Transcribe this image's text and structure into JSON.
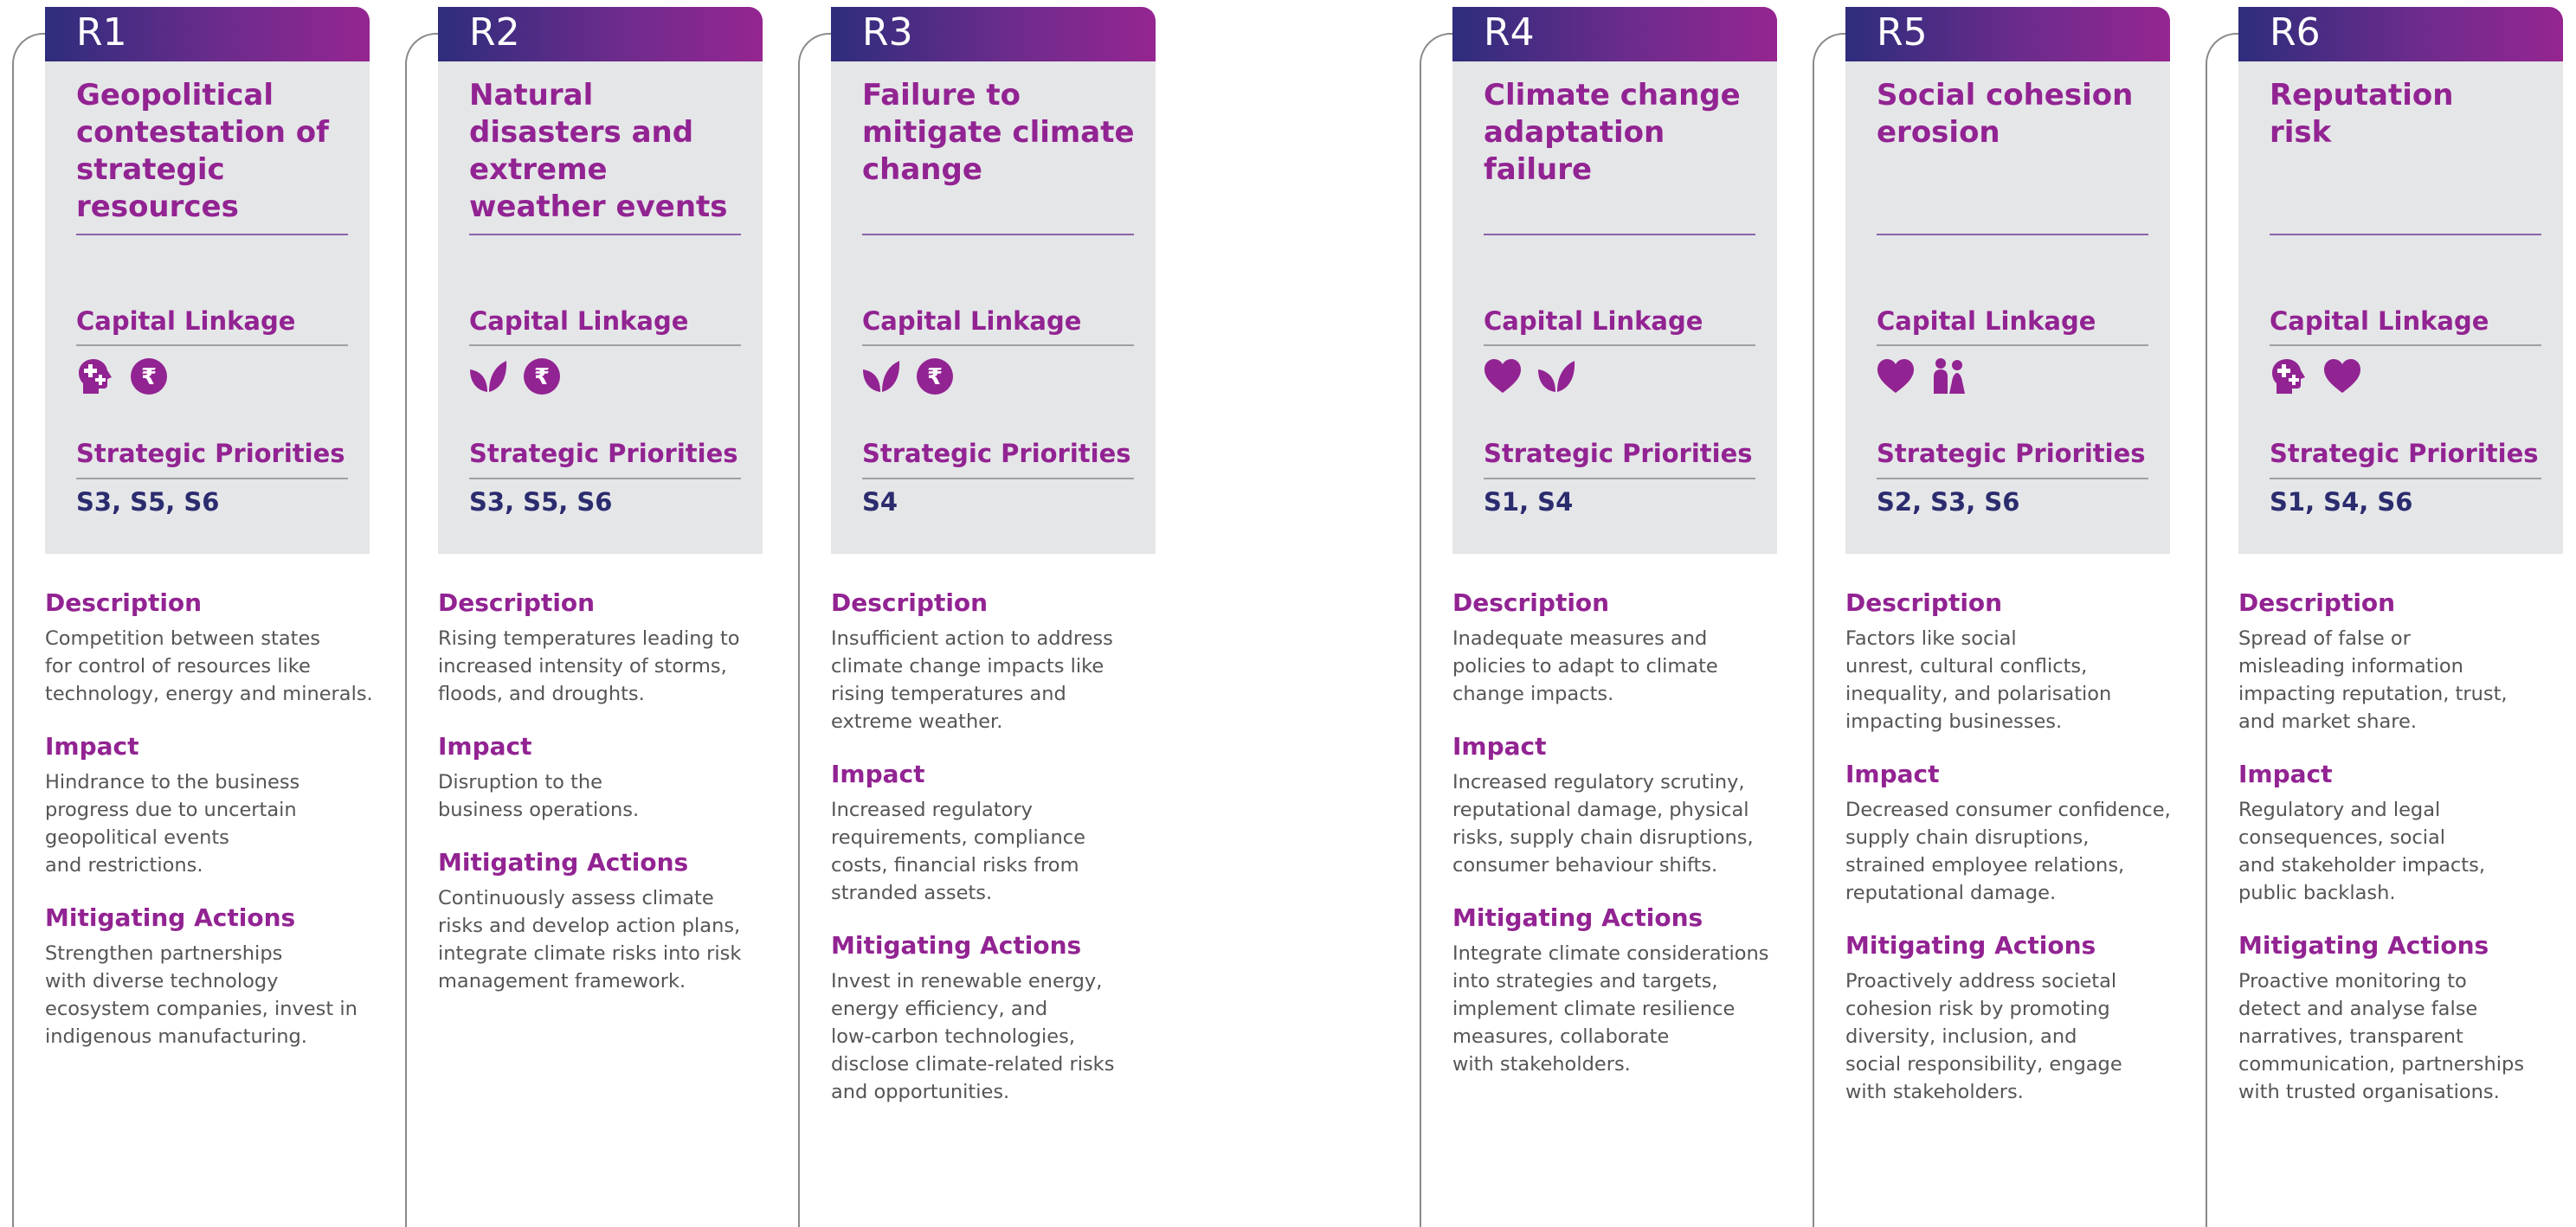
{
  "labels": {
    "capital_linkage": "Capital Linkage",
    "strategic_priorities": "Strategic Priorities",
    "description": "Description",
    "impact": "Impact",
    "mitigating_actions": "Mitigating Actions"
  },
  "colors": {
    "purple": "#922392",
    "navy": "#2b2c6e",
    "panel_bg": "#e5e6e8",
    "header_gradient": [
      "#2e2d7c",
      "#952591"
    ]
  },
  "risks": [
    {
      "id": "R1",
      "title": "Geopolitical contestation of strategic resources",
      "capital_icons": [
        "head-plus-icon",
        "rupee-icon"
      ],
      "priorities": "S3, S5, S6",
      "description": "Competition between states\nfor control of resources like\ntechnology, energy and minerals.",
      "impact": "Hindrance to the business\nprogress due to uncertain\ngeopolitical events\nand restrictions.",
      "mitigating": "Strengthen partnerships\nwith diverse technology\necosystem companies, invest in\nindigenous manufacturing."
    },
    {
      "id": "R2",
      "title": "Natural disasters and extreme weather events",
      "capital_icons": [
        "leaf-icon",
        "rupee-icon"
      ],
      "priorities": "S3, S5, S6",
      "description": "Rising temperatures leading to\nincreased intensity of storms,\nfloods, and droughts.",
      "impact": "Disruption to the\nbusiness operations.",
      "mitigating": "Continuously assess climate\nrisks and develop action plans,\nintegrate climate risks into risk\nmanagement framework."
    },
    {
      "id": "R3",
      "title": "Failure to mitigate climate change",
      "capital_icons": [
        "leaf-icon",
        "rupee-icon"
      ],
      "priorities": "S4",
      "description": "Insufficient action to address\nclimate change impacts like\nrising temperatures and\nextreme weather.",
      "impact": "Increased regulatory\nrequirements, compliance\ncosts, financial risks from\nstranded assets.",
      "mitigating": "Invest in renewable energy,\nenergy efficiency, and\nlow-carbon technologies,\ndisclose climate-related risks\nand opportunities."
    },
    {
      "id": "R4",
      "title": "Climate change adaptation failure",
      "capital_icons": [
        "heart-icon",
        "leaf-icon"
      ],
      "priorities": "S1, S4",
      "description": "Inadequate measures and\npolicies to adapt to climate\nchange impacts.",
      "impact": "Increased regulatory scrutiny,\nreputational damage, physical\nrisks, supply chain disruptions,\nconsumer behaviour shifts.",
      "mitigating": "Integrate climate considerations\ninto strategies and targets,\nimplement climate resilience\nmeasures, collaborate\nwith stakeholders."
    },
    {
      "id": "R5",
      "title": "Social cohesion erosion",
      "capital_icons": [
        "heart-icon",
        "people-icon"
      ],
      "priorities": "S2, S3, S6",
      "description": "Factors like social\nunrest, cultural conflicts,\ninequality, and polarisation\nimpacting businesses.",
      "impact": "Decreased consumer confidence,\nsupply chain disruptions,\nstrained employee relations,\nreputational damage.",
      "mitigating": "Proactively address societal\ncohesion risk by promoting\ndiversity, inclusion, and\nsocial responsibility, engage\nwith stakeholders."
    },
    {
      "id": "R6",
      "title": "Reputation risk",
      "capital_icons": [
        "head-plus-icon",
        "heart-icon"
      ],
      "priorities": "S1, S4, S6",
      "description": "Spread of false or\nmisleading information\nimpacting reputation, trust,\nand market share.",
      "impact": "Regulatory and legal\nconsequences, social\nand stakeholder impacts,\npublic backlash.",
      "mitigating": "Proactive monitoring to\ndetect and analyse false\nnarratives, transparent\ncommunication, partnerships\nwith trusted organisations."
    }
  ]
}
